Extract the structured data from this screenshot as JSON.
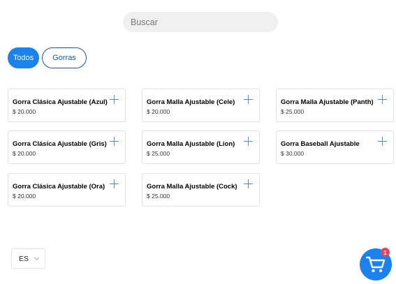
{
  "search": {
    "placeholder": "Buscar",
    "value": ""
  },
  "filters": [
    {
      "label": "Todos",
      "active": true
    },
    {
      "label": "Gorras",
      "active": false
    }
  ],
  "products": [
    {
      "name": "Gorra Clásica Ajustable (Azul)",
      "price": "$ 20.000"
    },
    {
      "name": "Gorra Malla Ajustable (Cele)",
      "price": "$ 20.000"
    },
    {
      "name": "Gorra Malla Ajustable (Panth)",
      "price": "$ 25.000"
    },
    {
      "name": "Gorra Clásica Ajustable (Gris)",
      "price": "$ 20.000"
    },
    {
      "name": "Gorra Malla Ajustable (Lion)",
      "price": "$ 25.000"
    },
    {
      "name": "Gorra Baseball Ajustable",
      "price": "$ 30.000"
    },
    {
      "name": "Gorra Clásica Ajustable (Ora)",
      "price": "$ 20.000"
    },
    {
      "name": "Gorra Malla Ajustable (Cock)",
      "price": "$ 25.000"
    }
  ],
  "language": {
    "selected": "ES"
  },
  "cart": {
    "count": "1"
  },
  "colors": {
    "accent": "#1a82ee",
    "chip_outline": "#1f5a94",
    "badge": "#e0475a"
  },
  "icons": [
    "plus-icon",
    "chevron-down-icon",
    "cart-icon"
  ]
}
